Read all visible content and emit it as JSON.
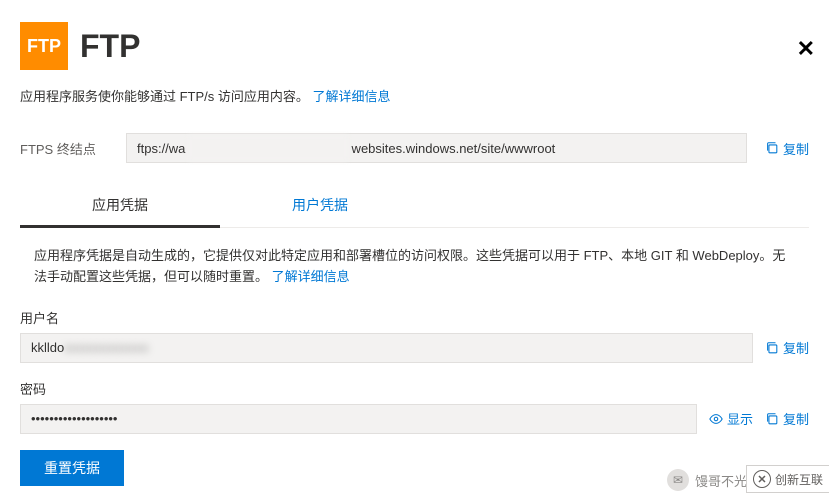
{
  "header": {
    "logo_text": "FTP",
    "title": "FTP"
  },
  "subtitle": {
    "text": "应用程序服务使你能够通过 FTP/s 访问应用内容。",
    "link": "了解详细信息"
  },
  "endpoint": {
    "label": "FTPS 终结点",
    "value": "ftps://wa                                              websites.windows.net/site/wwwroot",
    "copy": "复制"
  },
  "tabs": {
    "app_cred": "应用凭据",
    "user_cred": "用户凭据"
  },
  "desc": {
    "text": "应用程序凭据是自动生成的，它提供仅对此特定应用和部署槽位的访问权限。这些凭据可以用于 FTP、本地 GIT 和 WebDeploy。无法手动配置这些凭据，但可以随时重置。",
    "link": "了解详细信息"
  },
  "username": {
    "label": "用户名",
    "value": "kklldo",
    "masked": "xxxxxxxxxxxxx",
    "copy": "复制"
  },
  "password": {
    "label": "密码",
    "value": "•••••••••••••••••••",
    "show": "显示",
    "copy": "复制"
  },
  "actions": {
    "reset": "重置凭据"
  },
  "watermark": {
    "text": "馒哥不光会玩"
  },
  "brand": {
    "text": "创新互联"
  }
}
